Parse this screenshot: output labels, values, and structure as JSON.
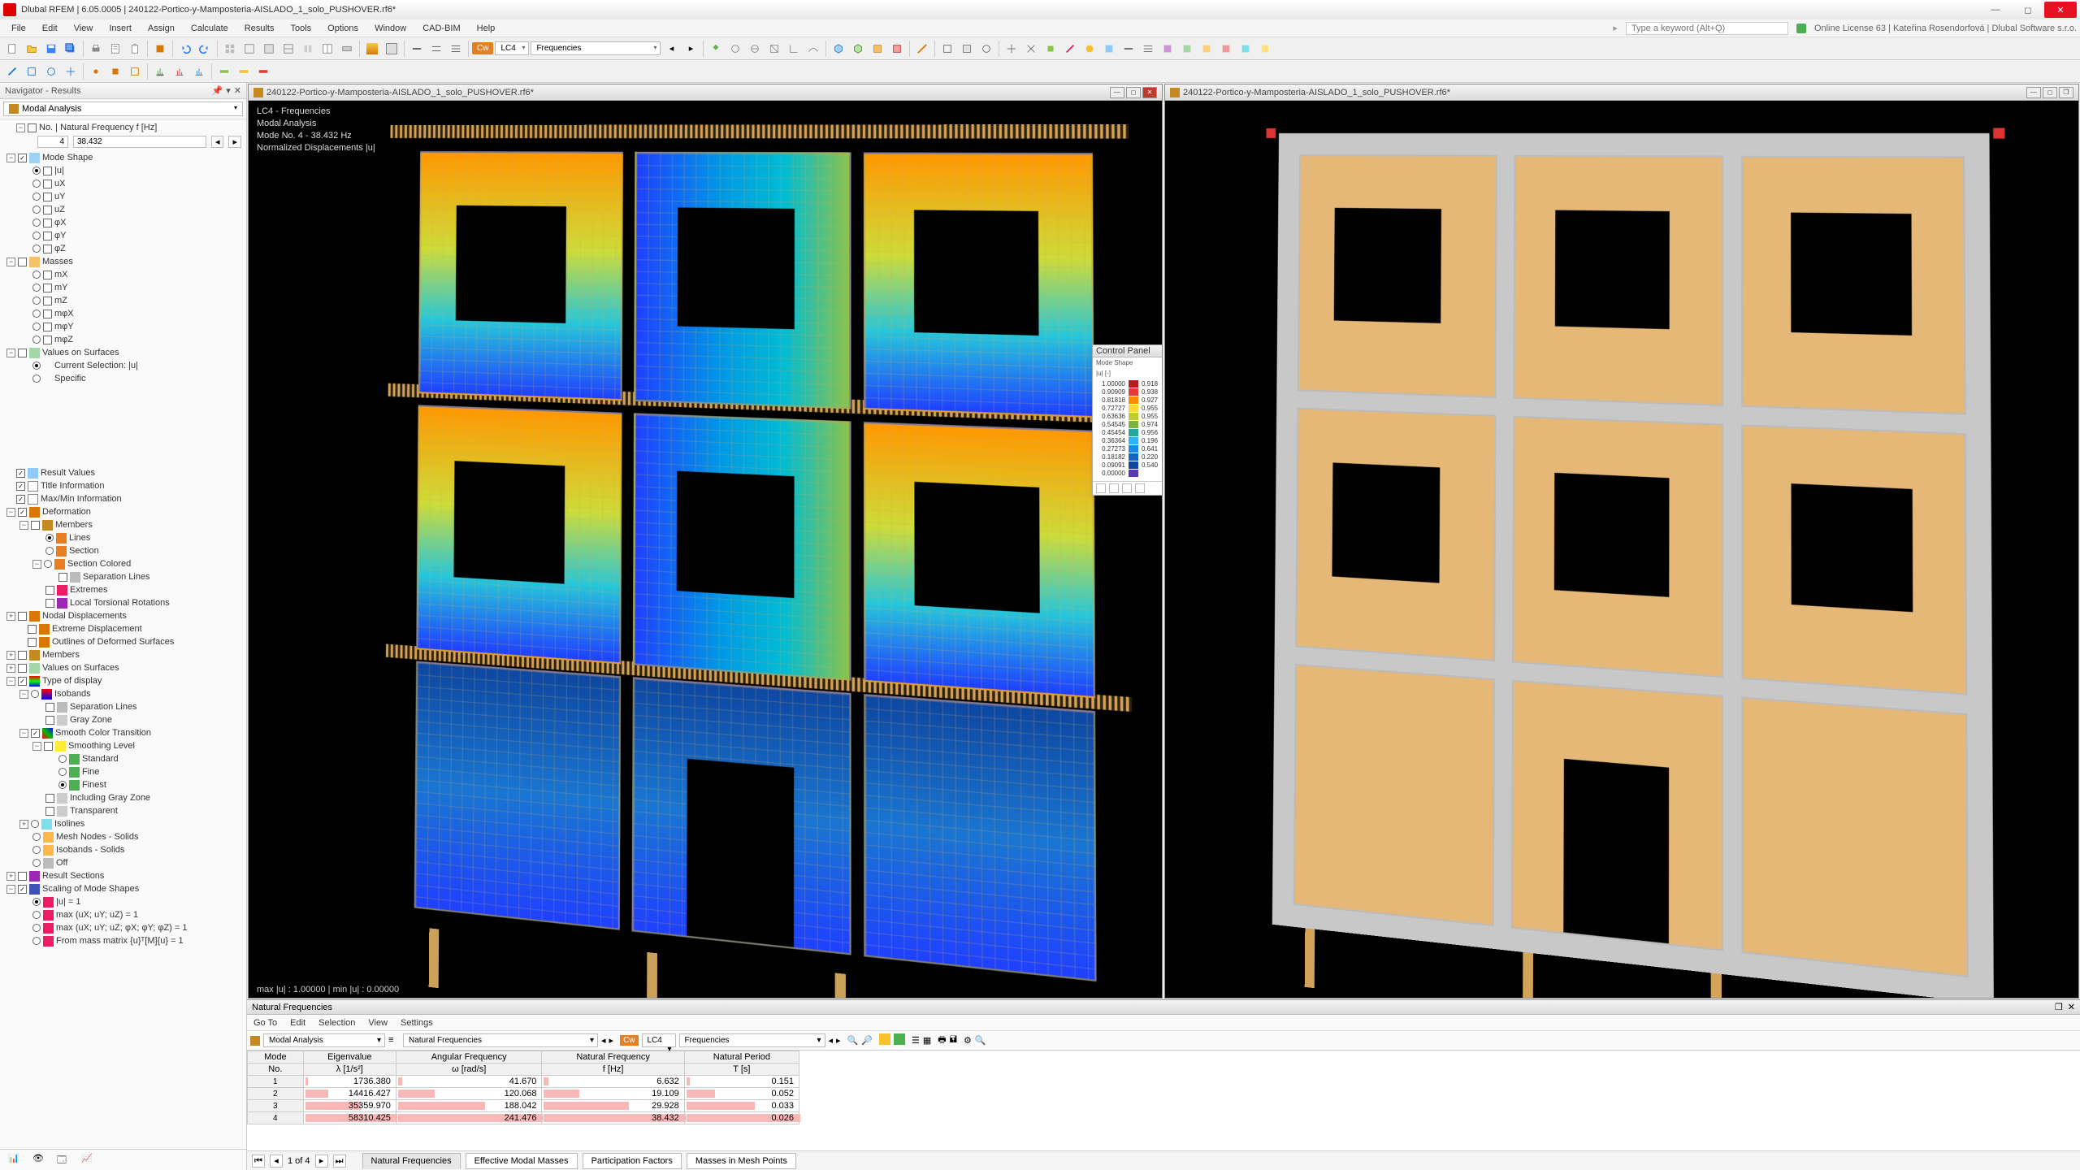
{
  "app": {
    "title": "Dlubal RFEM | 6.05.0005 | 240122-Portico-y-Mamposteria-AISLADO_1_solo_PUSHOVER.rf6*",
    "search_placeholder": "Type a keyword (Alt+Q)",
    "license": "Online License 63 | Kateřina Rosendorfová | Dlubal Software s.r.o."
  },
  "menu": {
    "items": [
      "File",
      "Edit",
      "View",
      "Insert",
      "Assign",
      "Calculate",
      "Results",
      "Tools",
      "Options",
      "Window",
      "CAD-BIM",
      "Help"
    ]
  },
  "toolbar_main": {
    "lc_label": "LC4",
    "combo_label": "Frequencies"
  },
  "navigator": {
    "title": "Navigator - Results",
    "combo": "Modal Analysis",
    "freq_header": "No. | Natural Frequency f [Hz]",
    "freq_no": "4",
    "freq_val": "38.432",
    "mode_shape": {
      "label": "Mode Shape",
      "items": [
        "|u|",
        "uX",
        "uY",
        "uZ",
        "φX",
        "φY",
        "φZ"
      ],
      "selected": 0
    },
    "masses": {
      "label": "Masses",
      "items": [
        "mX",
        "mY",
        "mZ",
        "mφX",
        "mφY",
        "mφZ"
      ]
    },
    "values_on_surfaces": {
      "label": "Values on Surfaces",
      "cur_sel": "Current Selection: |u|",
      "specific": "Specific"
    },
    "display_opts": {
      "result_values": "Result Values",
      "title_info": "Title Information",
      "maxmin": "Max/Min Information",
      "deformation": "Deformation",
      "members": "Members",
      "lines": "Lines",
      "section": "Section",
      "section_colored": "Section Colored",
      "sep_lines": "Separation Lines",
      "extremes": "Extremes",
      "local_tors": "Local Torsional Rotations",
      "nodal_disp": "Nodal Displacements",
      "extreme_disp": "Extreme Displacement",
      "outlines": "Outlines of Deformed Surfaces",
      "members2": "Members",
      "vos2": "Values on Surfaces",
      "type_display": "Type of display",
      "isobands": "Isobands",
      "sep_lines2": "Separation Lines",
      "gray_zone": "Gray Zone",
      "smooth": "Smooth Color Transition",
      "smooth_level": "Smoothing Level",
      "standard": "Standard",
      "fine": "Fine",
      "finest": "Finest",
      "incl_gray": "Including Gray Zone",
      "transparent": "Transparent",
      "isolines": "Isolines",
      "mesh_solids": "Mesh Nodes - Solids",
      "iso_solids": "Isobands - Solids",
      "off": "Off",
      "result_sections": "Result Sections",
      "scaling": "Scaling of Mode Shapes",
      "s1": "|u| = 1",
      "s2": "max (uX; uY; uZ) = 1",
      "s3": "max (uX; uY; uZ; φX; φY; φZ) = 1",
      "s4": "From mass matrix {u}ᵀ[M]{u} = 1"
    }
  },
  "viewport": {
    "doc_title": "240122-Portico-y-Mamposteria-AISLADO_1_solo_PUSHOVER.rf6*",
    "overlay_title": "LC4 - Frequencies",
    "overlay_l2": "Modal Analysis",
    "overlay_l3": "Mode No. 4 - 38.432 Hz",
    "overlay_l4": "Normalized Displacements |u|",
    "bottom": "max |u| : 1.00000 | min |u| : 0.00000"
  },
  "control_panel": {
    "title": "Control Panel",
    "sub1": "Mode Shape",
    "sub2": "|u| [-]",
    "rows": [
      {
        "l": "1.00000",
        "c": "#b71c1c",
        "r": "0.918"
      },
      {
        "l": "0.90909",
        "c": "#e53935",
        "r": "0.938"
      },
      {
        "l": "0.81818",
        "c": "#fb8c00",
        "r": "0.927"
      },
      {
        "l": "0.72727",
        "c": "#fdd835",
        "r": "0.955"
      },
      {
        "l": "0.63636",
        "c": "#c0ca33",
        "r": "0.955"
      },
      {
        "l": "0.54545",
        "c": "#7cb342",
        "r": "0.974"
      },
      {
        "l": "0.45454",
        "c": "#26a69a",
        "r": "0.956"
      },
      {
        "l": "0.36364",
        "c": "#29b6f6",
        "r": "0.196"
      },
      {
        "l": "0.27273",
        "c": "#1e88e5",
        "r": "0.641"
      },
      {
        "l": "0.18182",
        "c": "#1565c0",
        "r": "0.220"
      },
      {
        "l": "0.09091",
        "c": "#0d47a1",
        "r": "0.540"
      },
      {
        "l": "0.00000",
        "c": "#5e35b1",
        "r": ""
      }
    ]
  },
  "results": {
    "title": "Natural Frequencies",
    "menus": [
      "Go To",
      "Edit",
      "Selection",
      "View",
      "Settings"
    ],
    "combo1": "Modal Analysis",
    "combo2": "Natural Frequencies",
    "lc": "LC4",
    "lc_label": "Frequencies",
    "headers": {
      "mode": "Mode",
      "no": "No.",
      "eig": "Eigenvalue",
      "eig_u": "λ [1/s²]",
      "ang": "Angular Frequency",
      "ang_u": "ω [rad/s]",
      "nat": "Natural Frequency",
      "nat_u": "f [Hz]",
      "per": "Natural Period",
      "per_u": "T [s]"
    },
    "rows": [
      {
        "n": "1",
        "eig": "1736.380",
        "ang": "41.670",
        "nat": "6.632",
        "per": "0.151",
        "w": 0.03
      },
      {
        "n": "2",
        "eig": "14416.427",
        "ang": "120.068",
        "nat": "19.109",
        "per": "0.052",
        "w": 0.25
      },
      {
        "n": "3",
        "eig": "35359.970",
        "ang": "188.042",
        "nat": "29.928",
        "per": "0.033",
        "w": 0.6
      },
      {
        "n": "4",
        "eig": "58310.425",
        "ang": "241.476",
        "nat": "38.432",
        "per": "0.026",
        "w": 1.0
      }
    ],
    "page": "1 of 4",
    "tabs": [
      "Natural Frequencies",
      "Effective Modal Masses",
      "Participation Factors",
      "Masses in Mesh Points"
    ]
  }
}
